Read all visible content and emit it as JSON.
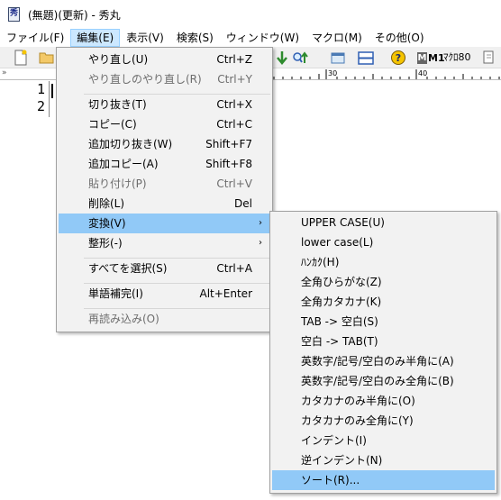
{
  "window": {
    "title": "(無題)(更新) - 秀丸",
    "icon": "hidemaru-app-icon"
  },
  "menubar": [
    {
      "label": "ファイル(F)",
      "name": "menu-file"
    },
    {
      "label": "編集(E)",
      "name": "menu-edit",
      "active": true
    },
    {
      "label": "表示(V)",
      "name": "menu-view"
    },
    {
      "label": "検索(S)",
      "name": "menu-search"
    },
    {
      "label": "ウィンドウ(W)",
      "name": "menu-window"
    },
    {
      "label": "マクロ(M)",
      "name": "menu-macro"
    },
    {
      "label": "その他(O)",
      "name": "menu-other"
    }
  ],
  "toolbar": {
    "icons": [
      "new-file-icon",
      "open-folder-icon",
      "down-arrow-icon",
      "search-next-icon",
      "window-icon",
      "split-window-icon",
      "help-icon",
      "macro-m1-icon",
      "macro80-icon",
      "find-replace-icon"
    ],
    "macro_m1_label": "M1",
    "macro80_label": "ﾏｸﾛ80"
  },
  "ruler": {
    "marks": [
      "30",
      "40"
    ],
    "chevron": "»"
  },
  "editor": {
    "line_numbers": [
      "1",
      "2"
    ]
  },
  "edit_menu": {
    "items": [
      {
        "label": "やり直し(U)",
        "shortcut": "Ctrl+Z",
        "enabled": true
      },
      {
        "label": "やり直しのやり直し(R)",
        "shortcut": "Ctrl+Y",
        "enabled": false
      },
      {
        "label": "切り抜き(T)",
        "shortcut": "Ctrl+X",
        "enabled": true
      },
      {
        "label": "コピー(C)",
        "shortcut": "Ctrl+C",
        "enabled": true
      },
      {
        "label": "追加切り抜き(W)",
        "shortcut": "Shift+F7",
        "enabled": true
      },
      {
        "label": "追加コピー(A)",
        "shortcut": "Shift+F8",
        "enabled": true
      },
      {
        "label": "貼り付け(P)",
        "shortcut": "Ctrl+V",
        "enabled": false
      },
      {
        "label": "削除(L)",
        "shortcut": "Del",
        "enabled": true
      },
      {
        "label": "変換(V)",
        "shortcut": "",
        "enabled": true,
        "submenu": true,
        "highlighted": true
      },
      {
        "label": "整形(-)",
        "shortcut": "",
        "enabled": true,
        "submenu": true
      },
      {
        "label": "すべてを選択(S)",
        "shortcut": "Ctrl+A",
        "enabled": true
      },
      {
        "label": "単語補完(I)",
        "shortcut": "Alt+Enter",
        "enabled": true
      },
      {
        "label": "再読み込み(O)",
        "shortcut": "",
        "enabled": false
      }
    ],
    "submenu_arrow": "›"
  },
  "convert_submenu": {
    "items": [
      {
        "label": "UPPER CASE(U)"
      },
      {
        "label": "lower case(L)"
      },
      {
        "label": "ﾊﾝｶｸ(H)"
      },
      {
        "label": "全角ひらがな(Z)"
      },
      {
        "label": "全角カタカナ(K)"
      },
      {
        "label": "TAB -> 空白(S)"
      },
      {
        "label": "空白 -> TAB(T)"
      },
      {
        "label": "英数字/記号/空白のみ半角に(A)"
      },
      {
        "label": "英数字/記号/空白のみ全角に(B)"
      },
      {
        "label": "カタカナのみ半角に(O)"
      },
      {
        "label": "カタカナのみ全角に(Y)"
      },
      {
        "label": "インデント(I)"
      },
      {
        "label": "逆インデント(N)"
      },
      {
        "label": "ソート(R)...",
        "highlighted": true
      }
    ]
  },
  "colors": {
    "highlight": "#91c9f7",
    "menubar_active": "#cce8ff",
    "menu_bg": "#f2f2f2",
    "disabled_text": "#6d6d6d"
  }
}
